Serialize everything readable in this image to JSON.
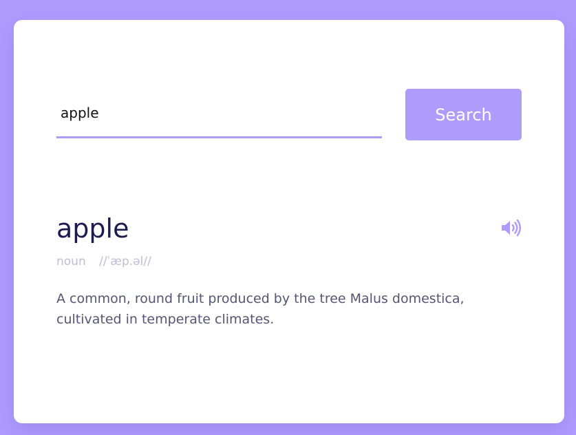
{
  "search": {
    "value": "apple",
    "button_label": "Search"
  },
  "result": {
    "word": "apple",
    "part_of_speech": "noun",
    "phonetic": "//ˈæp.əl//",
    "definition": "A common, round fruit produced by the tree Malus domestica, cultivated in temperate climates."
  },
  "icons": {
    "pronounce": "speaker-volume-icon"
  },
  "colors": {
    "background": "#ae9cfd",
    "accent": "#ae9cfd",
    "word_text": "#1d1a4e",
    "muted_text": "#c2bcd6",
    "definition_text": "#545573"
  }
}
